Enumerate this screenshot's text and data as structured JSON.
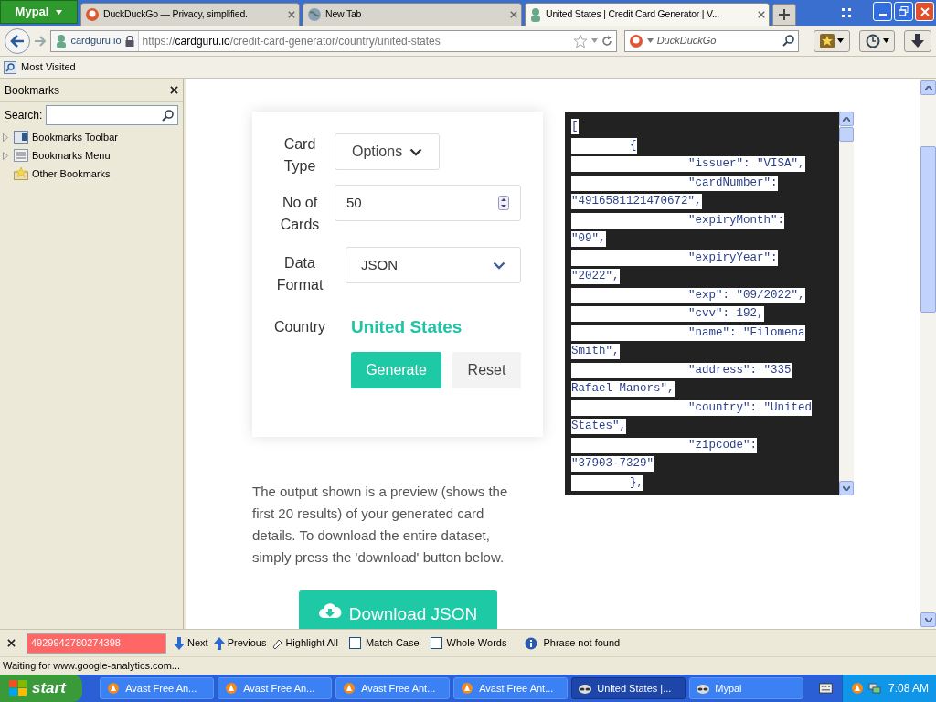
{
  "browser": {
    "menu_button": "Mypal",
    "tabs": [
      {
        "title": "DuckDuckGo — Privacy, simplified.",
        "kind": "duck",
        "selected": false
      },
      {
        "title": "New Tab",
        "kind": "globe",
        "selected": false
      },
      {
        "title": "United States | Credit Card Generator | V...",
        "kind": "site",
        "selected": true
      }
    ]
  },
  "nav": {
    "site_identity": "cardguru.io",
    "url_scheme": "https://",
    "url_host": "cardguru.io",
    "url_path": "/credit-card-generator/country/united-states",
    "search_placeholder": "DuckDuckGo"
  },
  "bookmarks_toolbar": [
    "Most Visited"
  ],
  "sidebar": {
    "title": "Bookmarks",
    "search_label": "Search:",
    "items": [
      {
        "label": "Bookmarks Toolbar",
        "kind": "toolbar",
        "expandable": true
      },
      {
        "label": "Bookmarks Menu",
        "kind": "menu",
        "expandable": true
      },
      {
        "label": "Other Bookmarks",
        "kind": "folder",
        "expandable": false
      }
    ]
  },
  "page": {
    "form": {
      "card_type_label": "Card Type",
      "card_type_value": "Options",
      "count_label": "No of Cards",
      "count_value": "50",
      "format_label": "Data Format",
      "format_value": "JSON",
      "country_label": "Country",
      "country_value": "United States",
      "generate_button": "Generate",
      "reset_button": "Reset"
    },
    "code_lines": [
      {
        "text": "[",
        "kind": "bracket"
      },
      {
        "text": "{",
        "kind": "brace"
      },
      {
        "text": "\"issuer\": \"VISA\",",
        "kind": "key"
      },
      {
        "text": "\"cardNumber\":",
        "kind": "key"
      },
      {
        "text": "\"4916581121470672\",",
        "kind": "wrap"
      },
      {
        "text": "\"expiryMonth\":",
        "kind": "key"
      },
      {
        "text": "\"09\",",
        "kind": "wrap"
      },
      {
        "text": "\"expiryYear\":",
        "kind": "key"
      },
      {
        "text": "\"2022\",",
        "kind": "wrap"
      },
      {
        "text": "\"exp\": \"09/2022\",",
        "kind": "key"
      },
      {
        "text": "\"cvv\": 192,",
        "kind": "key"
      },
      {
        "text": "\"name\": \"Filomena",
        "kind": "key"
      },
      {
        "text": "Smith\",",
        "kind": "wrap"
      },
      {
        "text": "\"address\": \"335",
        "kind": "key"
      },
      {
        "text": "Rafael Manors\",",
        "kind": "wrap"
      },
      {
        "text": "\"country\": \"United",
        "kind": "key"
      },
      {
        "text": "States\",",
        "kind": "wrap"
      },
      {
        "text": "\"zipcode\":",
        "kind": "key"
      },
      {
        "text": "\"37903-7329\"",
        "kind": "wrap"
      },
      {
        "text": "},",
        "kind": "brace"
      }
    ],
    "description": "The output shown is a preview (shows the first 20 results) of your generated card details. To download the entire dataset, simply press the 'download' button below.",
    "download_button": "Download JSON"
  },
  "find_bar": {
    "value": "4929942780274398",
    "not_found": true,
    "next": "Next",
    "previous": "Previous",
    "highlight": "Highlight All",
    "checkboxes": [
      {
        "label": "Match Case",
        "checked": false
      },
      {
        "label": "Whole Words",
        "checked": false
      }
    ],
    "message": "Phrase not found"
  },
  "status_bar": "Waiting for www.google-analytics.com...",
  "taskbar": {
    "start": "start",
    "items": [
      {
        "label": "Avast Free An...",
        "kind": "avast",
        "selected": false
      },
      {
        "label": "Avast Free An...",
        "kind": "avast",
        "selected": false
      },
      {
        "label": "Avast Free Ant...",
        "kind": "avast",
        "selected": false
      },
      {
        "label": "Avast Free Ant...",
        "kind": "avast",
        "selected": false
      },
      {
        "label": "United States |...",
        "kind": "raccoon",
        "selected": true
      },
      {
        "label": "Mypal",
        "kind": "raccoon",
        "selected": false
      }
    ],
    "clock": "7:08 AM"
  }
}
